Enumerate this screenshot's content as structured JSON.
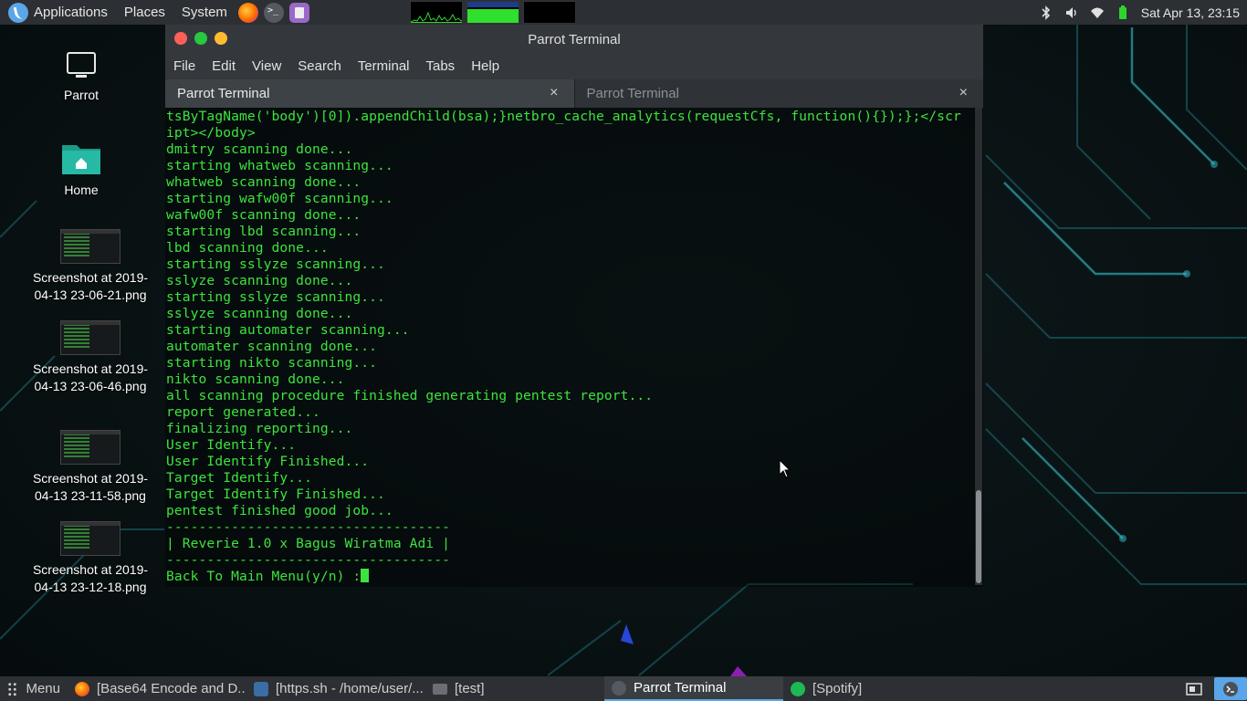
{
  "top_panel": {
    "applications": "Applications",
    "places": "Places",
    "system": "System",
    "clock": "Sat Apr 13, 23:15"
  },
  "desktop": {
    "icons": [
      {
        "label": "Parrot"
      },
      {
        "label": "Home"
      },
      {
        "label": "Screenshot at 2019-04-13 23-06-21.png"
      },
      {
        "label": "Screenshot at 2019-04-13 23-06-46.png"
      },
      {
        "label": "Screenshot at 2019-04-13 23-11-58.png"
      },
      {
        "label": "Screenshot at 2019-04-13 23-12-18.png"
      }
    ]
  },
  "window": {
    "title": "Parrot Terminal",
    "menu": [
      "File",
      "Edit",
      "View",
      "Search",
      "Terminal",
      "Tabs",
      "Help"
    ],
    "tabs": [
      {
        "label": "Parrot Terminal",
        "active": true
      },
      {
        "label": "Parrot Terminal",
        "active": false
      }
    ],
    "close_glyph": "×",
    "terminal": {
      "lines": [
        "tsByTagName('body')[0]).appendChild(bsa);}netbro_cache_analytics(requestCfs, function(){});};</scr",
        "ipt></body>",
        "dmitry scanning done...",
        "starting whatweb scanning...",
        "whatweb scanning done...",
        "starting wafw00f scanning...",
        "wafw00f scanning done...",
        "starting lbd scanning...",
        "lbd scanning done...",
        "starting sslyze scanning...",
        "sslyze scanning done...",
        "starting sslyze scanning...",
        "sslyze scanning done...",
        "starting automater scanning...",
        "automater scanning done...",
        "starting nikto scanning...",
        "nikto scanning done...",
        "all scanning procedure finished generating pentest report...",
        "report generated...",
        "finalizing reporting...",
        "User Identify...",
        "User Identify Finished...",
        "Target Identify...",
        "Target Identify Finished...",
        "pentest finished good job...",
        "-----------------------------------",
        "| Reverie 1.0 x Bagus Wiratma Adi |",
        "-----------------------------------"
      ],
      "prompt": "Back To Main Menu(y/n) :"
    }
  },
  "taskbar": {
    "menu_label": "Menu",
    "tasks": [
      {
        "label": "[Base64 Encode and D...",
        "icon": "firefox-icon",
        "active": false
      },
      {
        "label": "[https.sh - /home/user/...",
        "icon": "editor-icon",
        "active": false
      },
      {
        "label": "[test]",
        "icon": "folder-icon",
        "active": false
      },
      {
        "label": "Parrot Terminal",
        "icon": "terminal-icon",
        "active": true
      },
      {
        "label": "[Spotify]",
        "icon": "spotify-icon",
        "active": false
      }
    ]
  },
  "colors": {
    "terminal_text": "#3de43d",
    "panel_bg": "#2c2f33",
    "close_button": "#ff5f57",
    "maximize_button": "#28c840",
    "minimize_button": "#febc2e"
  }
}
